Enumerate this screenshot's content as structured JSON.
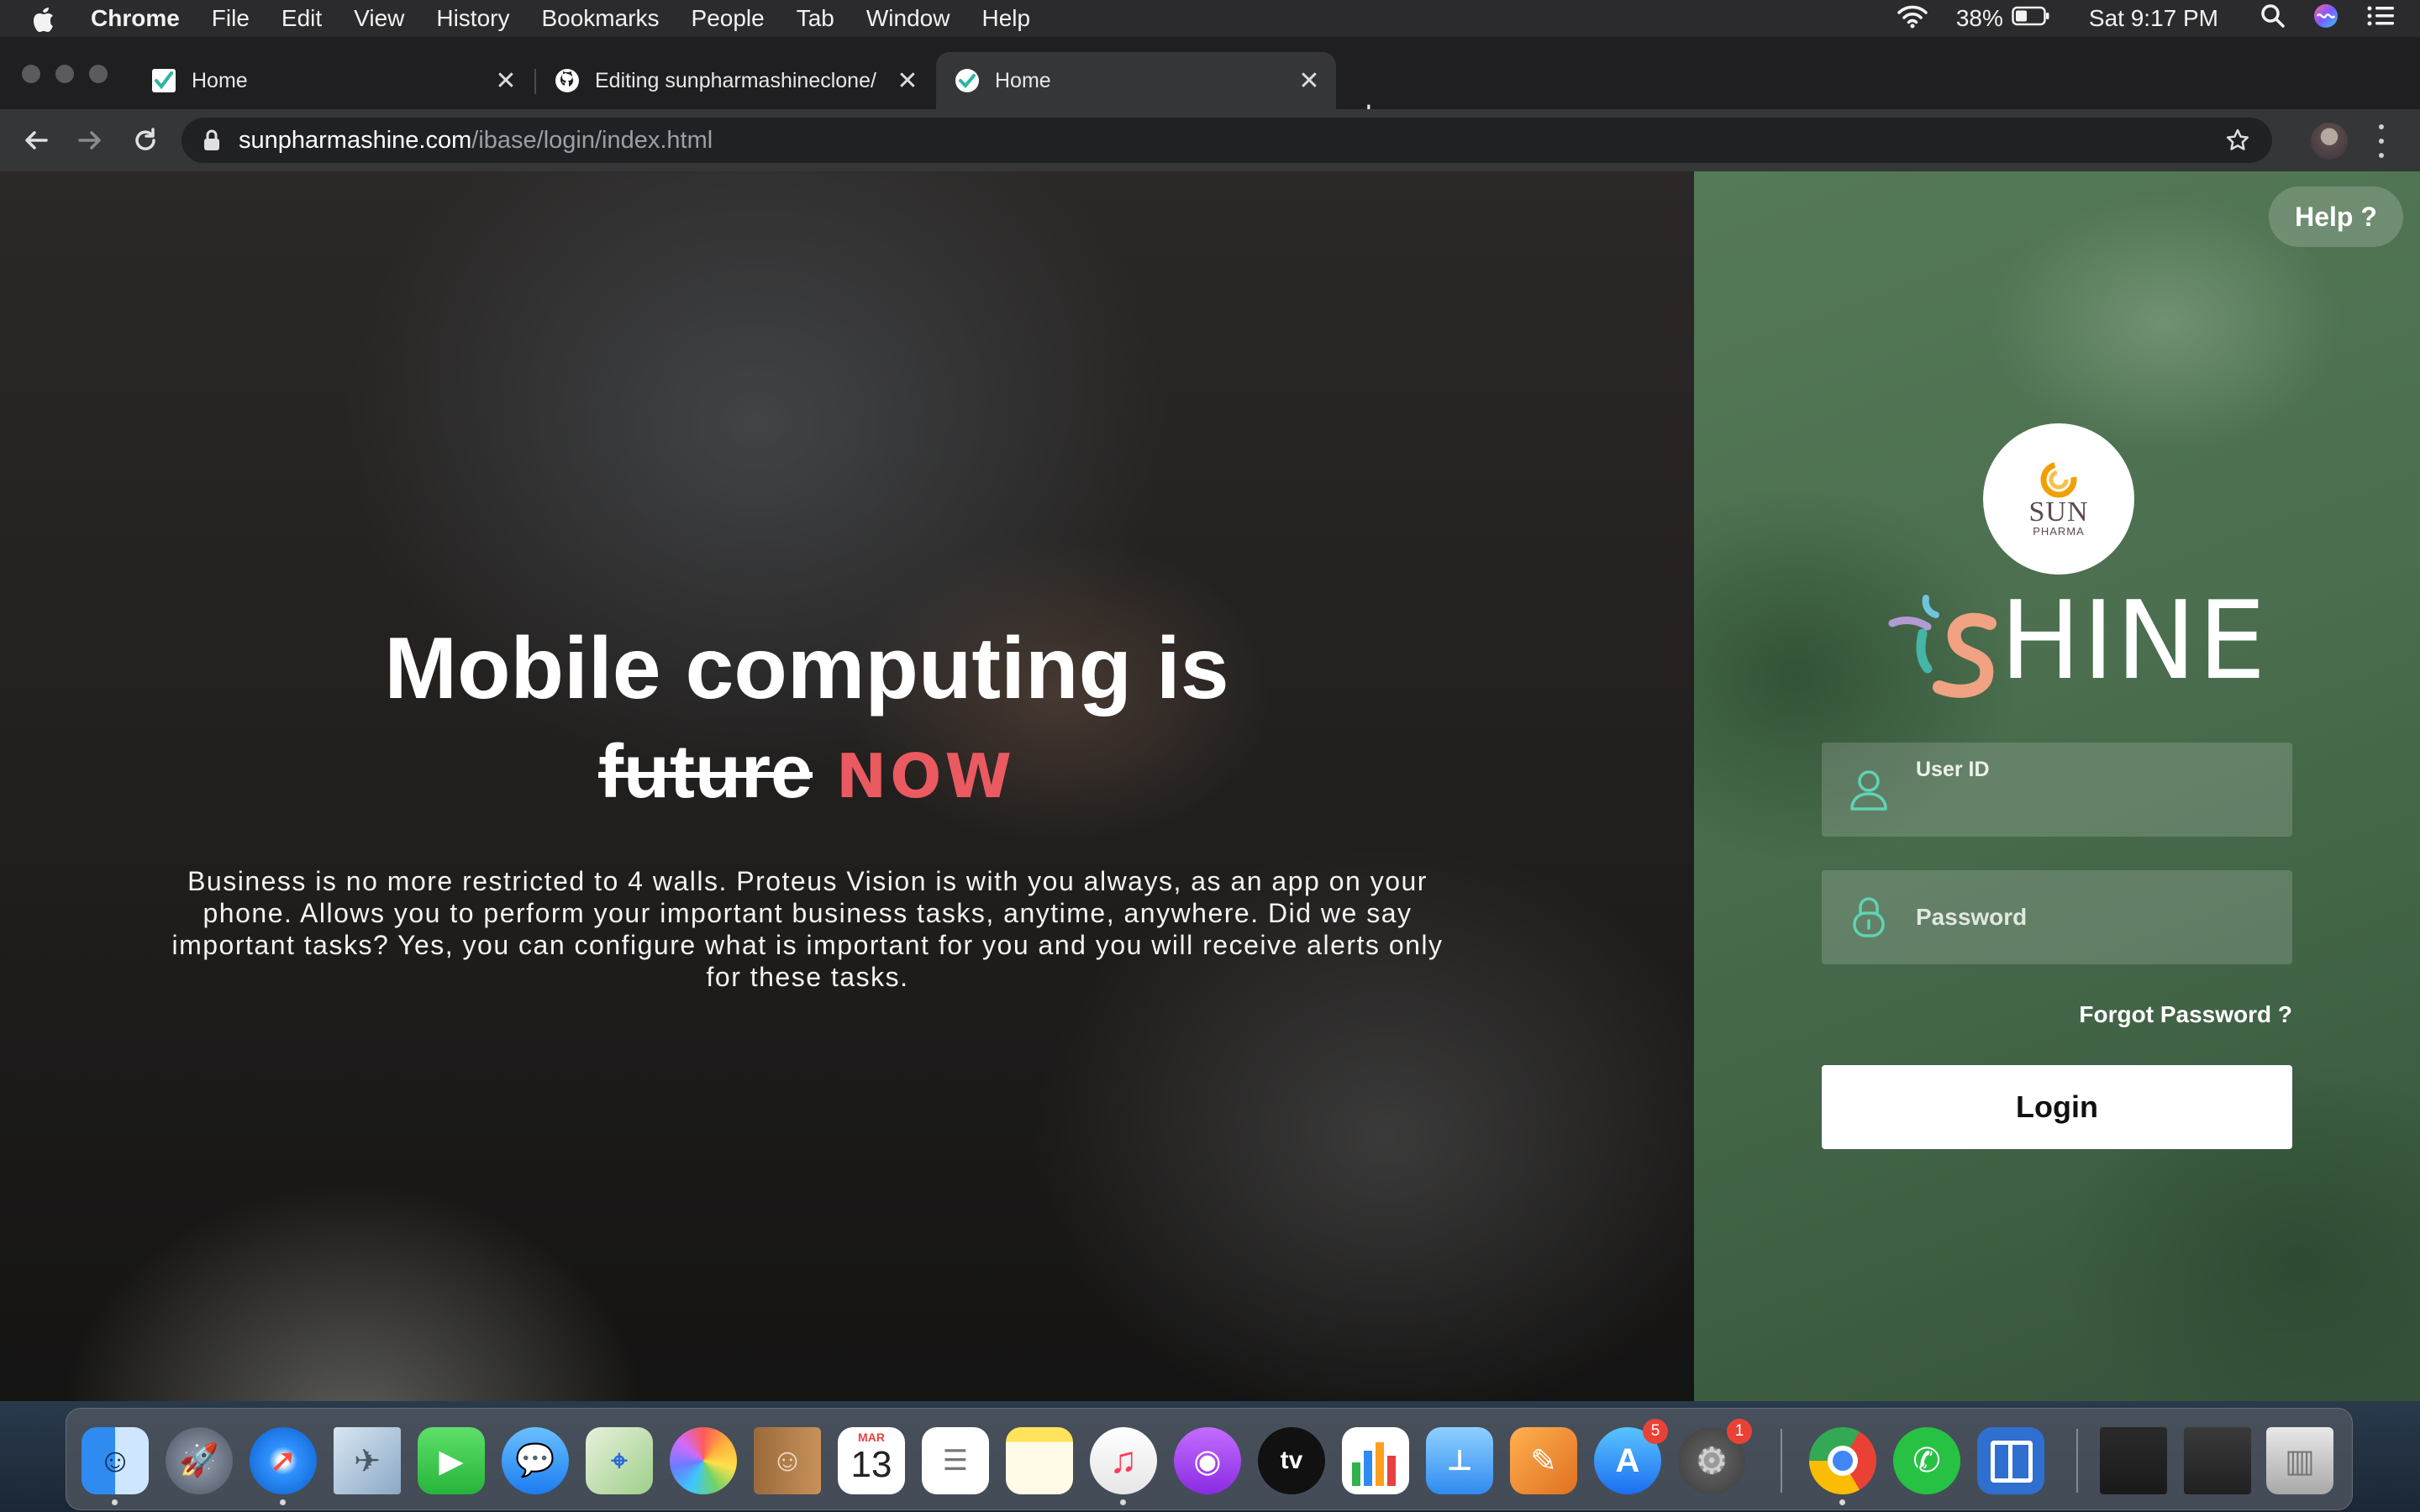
{
  "menubar": {
    "app_name": "Chrome",
    "menus": [
      "File",
      "Edit",
      "View",
      "History",
      "Bookmarks",
      "People",
      "Tab",
      "Window",
      "Help"
    ],
    "battery": "38%",
    "clock": "Sat 9:17 PM"
  },
  "tabs": [
    {
      "title": "Home",
      "favicon": "check-icon"
    },
    {
      "title": "Editing sunpharmashineclone/",
      "favicon": "github-icon"
    },
    {
      "title": "Home",
      "favicon": "check-icon",
      "active": true
    }
  ],
  "address_bar": {
    "domain": "sunpharmashine.com",
    "path": "/ibase/login/index.html"
  },
  "hero": {
    "title": "Mobile computing is",
    "struck_word": "future",
    "highlight_word": "NOW",
    "description": "Business is no more restricted to 4 walls. Proteus Vision is with you always, as an app on your phone. Allows you to perform your important business tasks, anytime, anywhere. Did we say important tasks? Yes, you can configure what is important for you and you will receive alerts only for these tasks."
  },
  "login": {
    "help_label": "Help ?",
    "logo_sun": "SUN",
    "logo_pharma": "PHARMA",
    "brand_initial": "i",
    "brand_s": "S",
    "brand_rest": "HINE",
    "user_id_label": "User ID",
    "password_placeholder": "Password",
    "forgot_label": "Forgot Password ?",
    "login_label": "Login"
  },
  "dock": {
    "calendar_month": "MAR",
    "calendar_day": "13",
    "tv_label": "tv",
    "app_store_badge": "5",
    "settings_badge": "1"
  },
  "colors": {
    "accent_now": "#ea5a60",
    "panel_green": "#4b6f4f",
    "brand_teal": "#45b5a8",
    "brand_peach": "#f0a282"
  }
}
